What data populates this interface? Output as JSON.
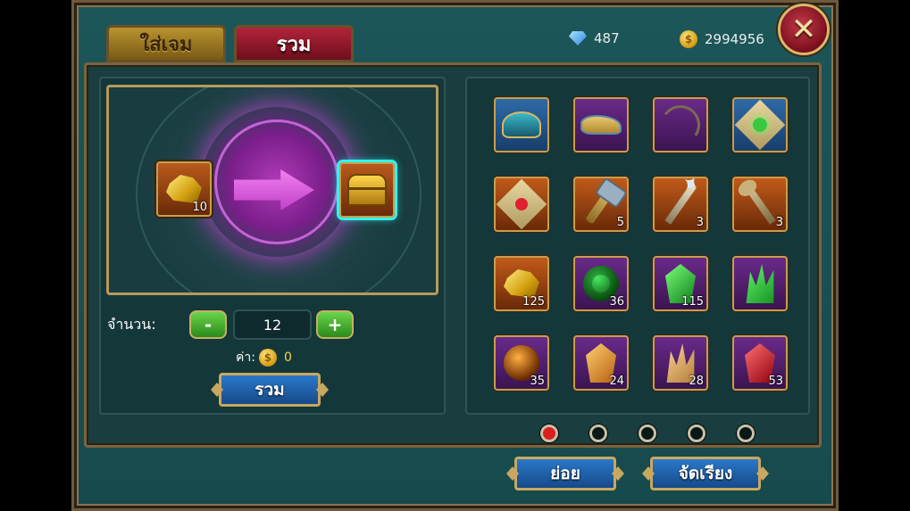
{
  "tabs": [
    {
      "label": "ใส่เจม",
      "active": true
    },
    {
      "label": "รวม",
      "active": false
    }
  ],
  "currency": {
    "gems": "487",
    "gold": "2994956"
  },
  "craft": {
    "source_qty": "10",
    "amount_label": "จำนวน:",
    "minus_label": "-",
    "plus_label": "+",
    "quantity": "12",
    "cost_label": "ค่า:",
    "cost_value": "0",
    "combine_label": "รวม"
  },
  "inventory": {
    "items": [
      {
        "icon": "hat-icon",
        "qty": ""
      },
      {
        "icon": "shoe-icon",
        "qty": ""
      },
      {
        "icon": "bow-icon",
        "qty": ""
      },
      {
        "icon": "green-scroll-icon",
        "qty": ""
      },
      {
        "icon": "red-scroll-icon",
        "qty": ""
      },
      {
        "icon": "mace-icon",
        "qty": "5"
      },
      {
        "icon": "star-staff-icon",
        "qty": "3"
      },
      {
        "icon": "key-icon",
        "qty": "3"
      },
      {
        "icon": "gold-ore-icon",
        "qty": "125"
      },
      {
        "icon": "green-orb-icon",
        "qty": "36"
      },
      {
        "icon": "green-gem-icon",
        "qty": "115"
      },
      {
        "icon": "green-crystal-icon",
        "qty": ""
      },
      {
        "icon": "amber-orb-icon",
        "qty": "35"
      },
      {
        "icon": "orange-gem-icon",
        "qty": "24"
      },
      {
        "icon": "tan-crystal-icon",
        "qty": "28"
      },
      {
        "icon": "red-gem-icon",
        "qty": "53"
      }
    ],
    "page_count": 5,
    "current_page": 1
  },
  "actions": {
    "disassemble_label": "ย่อย",
    "sort_label": "จัดเรียง"
  },
  "colors": {
    "frame": "#1d5658",
    "accent_gold": "#c8a860",
    "button_blue": "#2a78c8",
    "tab_red": "#b2233a"
  }
}
